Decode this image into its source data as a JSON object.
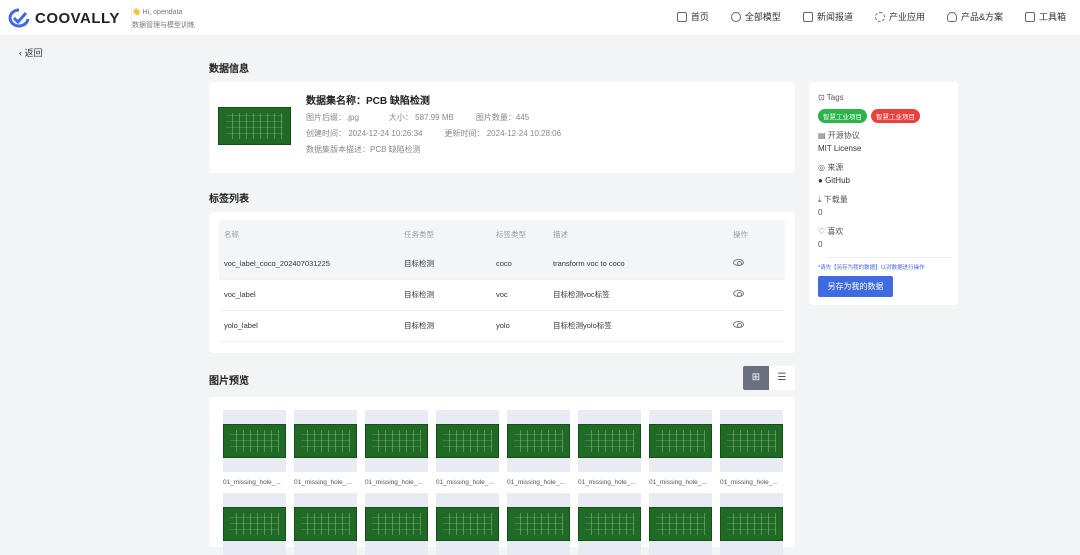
{
  "header": {
    "logo": "COOVALLY",
    "greeting": "👋 Hi,  opendata",
    "subtitle": "数据管理与模型训练",
    "nav": [
      "首页",
      "全部模型",
      "新闻报道",
      "产业应用",
      "产品&方案",
      "工具箱"
    ]
  },
  "back": "返回",
  "sections": {
    "info": "数据信息",
    "labels": "标签列表",
    "preview": "图片预览"
  },
  "dataset": {
    "name": "数据集名称：PCB 缺陷检测",
    "suffix": "图片后缀：.jpg",
    "size": "大小：  587.99 MB",
    "count": "图片数量：445",
    "created": "创建时间：  2024-12-24 10:26:34",
    "updated": "更新时间：  2024-12-24 10:28:06",
    "desc": "数据集版本描述：PCB 缺陷检测"
  },
  "table": {
    "headers": [
      "名称",
      "任务类型",
      "标签类型",
      "描述",
      "操作"
    ],
    "rows": [
      [
        "voc_label_coco_202407031225",
        "目标检测",
        "coco",
        "transform voc to coco"
      ],
      [
        "voc_label",
        "目标检测",
        "voc",
        "目标检测voc标签"
      ],
      [
        "yolo_label",
        "目标检测",
        "yolo",
        "目标检测yolo标签"
      ]
    ]
  },
  "images": {
    "caption": "01_missing_hole_..."
  },
  "side": {
    "tags_label": "Tags",
    "tags": [
      {
        "text": "智慧工业项目",
        "color": "#2bb44a"
      },
      {
        "text": "智慧工业项目",
        "color": "#e8413f"
      }
    ],
    "license_label": "开源协议",
    "license": "MIT License",
    "source_label": "来源",
    "source": "GitHub",
    "downloads_label": "下载量",
    "downloads": "0",
    "likes_label": "喜欢",
    "likes": "0",
    "hint": "*请先【另存为我的数据】以对数据进行操作",
    "save": "另存为我的数据"
  }
}
